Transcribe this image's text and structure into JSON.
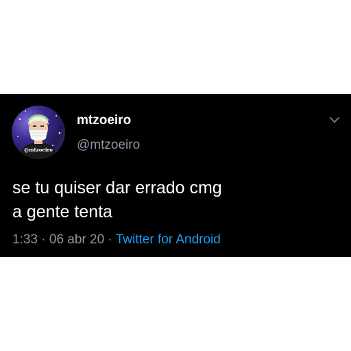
{
  "tweet": {
    "author": {
      "display_name": "mtzoeiro",
      "handle": "@mtzoeiro",
      "avatar_caption": "@mtzoeiro"
    },
    "text_lines": [
      "se tu quiser dar errado cmg",
      "a gente tenta"
    ],
    "meta": {
      "time": "1:33",
      "separator": "·",
      "date": "06 abr 20",
      "source": "Twitter for Android"
    },
    "menu_icon": "chevron-down-icon"
  },
  "colors": {
    "background": "#000000",
    "text_primary": "#ffffff",
    "text_secondary": "#8b98a5",
    "link": "#1d9bf0"
  }
}
